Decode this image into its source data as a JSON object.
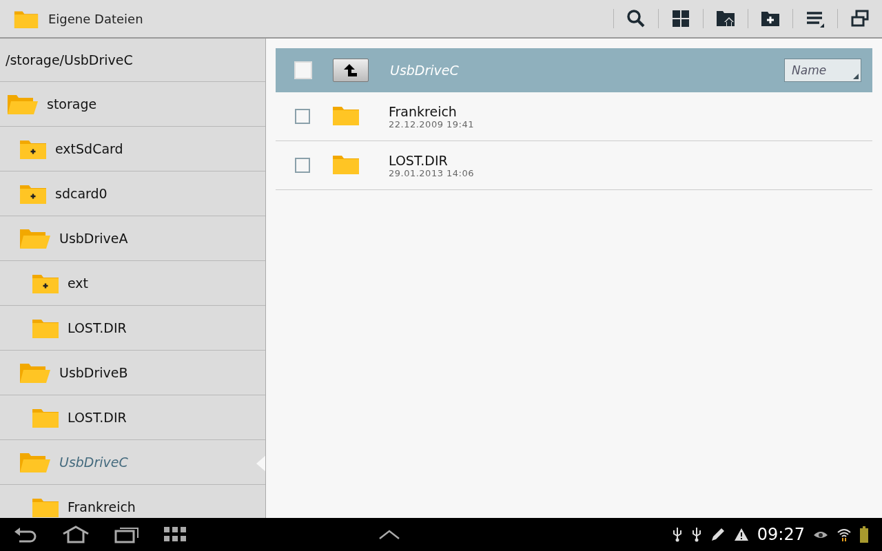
{
  "action_bar": {
    "title": "Eigene Dateien"
  },
  "sidebar": {
    "path": "/storage/UsbDriveC",
    "tree": [
      {
        "label": "storage",
        "kind": "open",
        "selected": false,
        "children": [
          {
            "label": "extSdCard",
            "kind": "plus",
            "selected": false
          },
          {
            "label": "sdcard0",
            "kind": "plus",
            "selected": false
          },
          {
            "label": "UsbDriveA",
            "kind": "open",
            "selected": false,
            "children": [
              {
                "label": "ext",
                "kind": "plus",
                "selected": false
              },
              {
                "label": "LOST.DIR",
                "kind": "plain",
                "selected": false
              }
            ]
          },
          {
            "label": "UsbDriveB",
            "kind": "open",
            "selected": false,
            "children": [
              {
                "label": "LOST.DIR",
                "kind": "plain",
                "selected": false
              }
            ]
          },
          {
            "label": "UsbDriveC",
            "kind": "open",
            "selected": true,
            "children": [
              {
                "label": "Frankreich",
                "kind": "plain",
                "selected": false
              }
            ]
          }
        ]
      }
    ]
  },
  "list": {
    "header": {
      "title": "UsbDriveC",
      "checked": false,
      "sort": "Name"
    },
    "rows": [
      {
        "name": "Frankreich",
        "date": "22.12.2009 19:41",
        "checked": false
      },
      {
        "name": "LOST.DIR",
        "date": "29.01.2013 14:06",
        "checked": false
      }
    ]
  },
  "status_bar": {
    "time": "09:27"
  }
}
